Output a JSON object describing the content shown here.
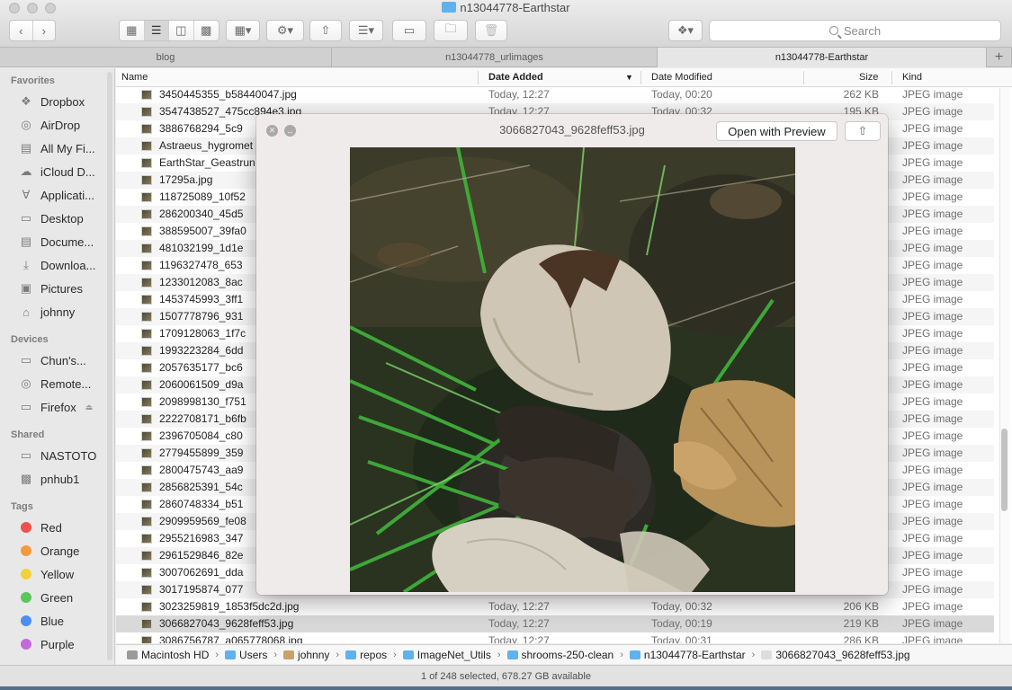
{
  "window": {
    "title": "n13044778-Earthstar",
    "search_placeholder": "Search"
  },
  "tabs": [
    {
      "label": "blog",
      "active": false
    },
    {
      "label": "n13044778_urlimages",
      "active": false
    },
    {
      "label": "n13044778-Earthstar",
      "active": true
    }
  ],
  "sidebar": {
    "favorites_header": "Favorites",
    "favorites": [
      {
        "label": "Dropbox",
        "icon": "dropbox-icon"
      },
      {
        "label": "AirDrop",
        "icon": "airdrop-icon"
      },
      {
        "label": "All My Fi...",
        "icon": "all-my-files-icon"
      },
      {
        "label": "iCloud D...",
        "icon": "icloud-icon"
      },
      {
        "label": "Applicati...",
        "icon": "applications-icon"
      },
      {
        "label": "Desktop",
        "icon": "desktop-icon"
      },
      {
        "label": "Docume...",
        "icon": "documents-icon"
      },
      {
        "label": "Downloa...",
        "icon": "downloads-icon"
      },
      {
        "label": "Pictures",
        "icon": "pictures-icon"
      },
      {
        "label": "johnny",
        "icon": "home-icon"
      }
    ],
    "devices_header": "Devices",
    "devices": [
      {
        "label": "Chun's...",
        "icon": "laptop-icon"
      },
      {
        "label": "Remote...",
        "icon": "remote-disc-icon"
      },
      {
        "label": "Firefox",
        "icon": "disk-icon"
      }
    ],
    "shared_header": "Shared",
    "shared": [
      {
        "label": "NASTOTO",
        "icon": "server-icon"
      },
      {
        "label": "pnhub1",
        "icon": "computer-icon"
      }
    ],
    "tags_header": "Tags",
    "tags": [
      {
        "label": "Red",
        "color": "#f1504d"
      },
      {
        "label": "Orange",
        "color": "#f49a3a"
      },
      {
        "label": "Yellow",
        "color": "#f4d03a"
      },
      {
        "label": "Green",
        "color": "#5bc65a"
      },
      {
        "label": "Blue",
        "color": "#4a8ef0"
      },
      {
        "label": "Purple",
        "color": "#c36ad8"
      }
    ]
  },
  "columns": {
    "name": "Name",
    "date_added": "Date Added",
    "date_modified": "Date Modified",
    "size": "Size",
    "kind": "Kind"
  },
  "files": [
    {
      "name": "3450445355_b58440047.jpg",
      "added": "Today, 12:27",
      "modified": "Today, 00:20",
      "size": "262 KB",
      "kind": "JPEG image"
    },
    {
      "name": "3547438527_475cc894e3.jpg",
      "added": "Today, 12:27",
      "modified": "Today, 00:32",
      "size": "195 KB",
      "kind": "JPEG image"
    },
    {
      "name": "3886768294_5c9",
      "added": "",
      "modified": "",
      "size": "",
      "kind": "JPEG image"
    },
    {
      "name": "Astraeus_hygromet",
      "added": "",
      "modified": "",
      "size": "",
      "kind": "JPEG image"
    },
    {
      "name": "EarthStar_Geastrun",
      "added": "",
      "modified": "",
      "size": "",
      "kind": "JPEG image"
    },
    {
      "name": "17295a.jpg",
      "added": "",
      "modified": "",
      "size": "",
      "kind": "JPEG image"
    },
    {
      "name": "118725089_10f52",
      "added": "",
      "modified": "",
      "size": "",
      "kind": "JPEG image"
    },
    {
      "name": "286200340_45d5",
      "added": "",
      "modified": "",
      "size": "",
      "kind": "JPEG image"
    },
    {
      "name": "388595007_39fa0",
      "added": "",
      "modified": "",
      "size": "",
      "kind": "JPEG image"
    },
    {
      "name": "481032199_1d1e",
      "added": "",
      "modified": "",
      "size": "",
      "kind": "JPEG image"
    },
    {
      "name": "1196327478_653",
      "added": "",
      "modified": "",
      "size": "",
      "kind": "JPEG image"
    },
    {
      "name": "1233012083_8ac",
      "added": "",
      "modified": "",
      "size": "",
      "kind": "JPEG image"
    },
    {
      "name": "1453745993_3ff1",
      "added": "",
      "modified": "",
      "size": "",
      "kind": "JPEG image"
    },
    {
      "name": "1507778796_931",
      "added": "",
      "modified": "",
      "size": "",
      "kind": "JPEG image"
    },
    {
      "name": "1709128063_1f7c",
      "added": "",
      "modified": "",
      "size": "",
      "kind": "JPEG image"
    },
    {
      "name": "1993223284_6dd",
      "added": "",
      "modified": "",
      "size": "",
      "kind": "JPEG image"
    },
    {
      "name": "2057635177_bc6",
      "added": "",
      "modified": "",
      "size": "",
      "kind": "JPEG image"
    },
    {
      "name": "2060061509_d9a",
      "added": "",
      "modified": "",
      "size": "",
      "kind": "JPEG image"
    },
    {
      "name": "2098998130_f751",
      "added": "",
      "modified": "",
      "size": "",
      "kind": "JPEG image"
    },
    {
      "name": "2222708171_b6fb",
      "added": "",
      "modified": "",
      "size": "",
      "kind": "JPEG image"
    },
    {
      "name": "2396705084_c80",
      "added": "",
      "modified": "",
      "size": "",
      "kind": "JPEG image"
    },
    {
      "name": "2779455899_359",
      "added": "",
      "modified": "",
      "size": "",
      "kind": "JPEG image"
    },
    {
      "name": "2800475743_aa9",
      "added": "",
      "modified": "",
      "size": "",
      "kind": "JPEG image"
    },
    {
      "name": "2856825391_54c",
      "added": "",
      "modified": "",
      "size": "",
      "kind": "JPEG image"
    },
    {
      "name": "2860748334_b51",
      "added": "",
      "modified": "",
      "size": "",
      "kind": "JPEG image"
    },
    {
      "name": "2909959569_fe08",
      "added": "",
      "modified": "",
      "size": "",
      "kind": "JPEG image"
    },
    {
      "name": "2955216983_347",
      "added": "",
      "modified": "",
      "size": "",
      "kind": "JPEG image"
    },
    {
      "name": "2961529846_82e",
      "added": "",
      "modified": "",
      "size": "",
      "kind": "JPEG image"
    },
    {
      "name": "3007062691_dda",
      "added": "",
      "modified": "",
      "size": "",
      "kind": "JPEG image"
    },
    {
      "name": "3017195874_077",
      "added": "",
      "modified": "",
      "size": "",
      "kind": "JPEG image"
    },
    {
      "name": "3023259819_1853f5dc2d.jpg",
      "added": "Today, 12:27",
      "modified": "Today, 00:32",
      "size": "206 KB",
      "kind": "JPEG image"
    },
    {
      "name": "3066827043_9628feff53.jpg",
      "added": "Today, 12:27",
      "modified": "Today, 00:19",
      "size": "219 KB",
      "kind": "JPEG image",
      "selected": true
    },
    {
      "name": "3086756787_a065778068.jpg",
      "added": "Today, 12:27",
      "modified": "Today, 00:31",
      "size": "286 KB",
      "kind": "JPEG image"
    }
  ],
  "pathbar": [
    {
      "label": "Macintosh HD",
      "icon": "hard-drive-icon",
      "color": "#9a9a9a"
    },
    {
      "label": "Users",
      "icon": "folder-icon",
      "color": "#5fb2ee"
    },
    {
      "label": "johnny",
      "icon": "home-icon",
      "color": "#c9a26a"
    },
    {
      "label": "repos",
      "icon": "folder-icon",
      "color": "#5fb2ee"
    },
    {
      "label": "ImageNet_Utils",
      "icon": "folder-icon",
      "color": "#5fb2ee"
    },
    {
      "label": "shrooms-250-clean",
      "icon": "folder-icon",
      "color": "#5fb2ee"
    },
    {
      "label": "n13044778-Earthstar",
      "icon": "folder-icon",
      "color": "#5fb2ee"
    },
    {
      "label": "3066827043_9628feff53.jpg",
      "icon": "jpeg-file-icon",
      "color": "#dddddd"
    }
  ],
  "status": "1 of 248 selected, 678.27 GB available",
  "quicklook": {
    "title": "3066827043_9628feff53.jpg",
    "open_with_label": "Open with Preview"
  }
}
